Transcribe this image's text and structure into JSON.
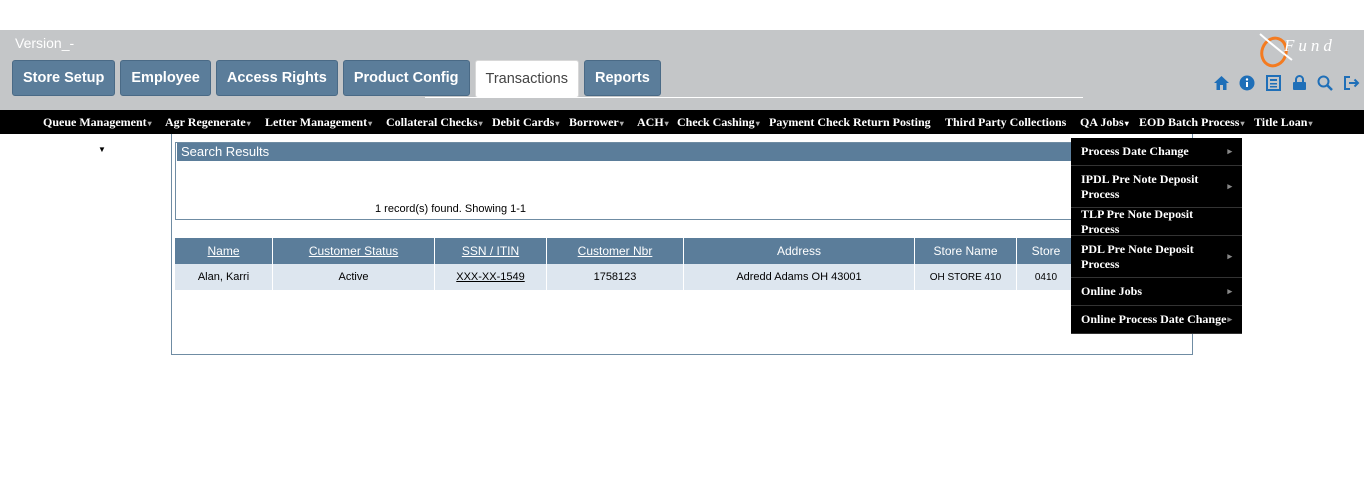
{
  "header": {
    "version": "Version_-",
    "tabs": [
      {
        "label": "Store Setup",
        "active": false
      },
      {
        "label": "Employee",
        "active": false
      },
      {
        "label": "Access Rights",
        "active": false
      },
      {
        "label": "Product Config",
        "active": false
      },
      {
        "label": "Transactions",
        "active": true
      },
      {
        "label": "Reports",
        "active": false
      }
    ],
    "logo_text": "Fund",
    "icons": [
      "home-icon",
      "info-icon",
      "calculator-icon",
      "lock-icon",
      "search-icon",
      "logout-icon"
    ]
  },
  "nav": {
    "items": [
      {
        "label": "Queue Management",
        "caret": "▾"
      },
      {
        "label": "Agr Regenerate",
        "caret": "▾"
      },
      {
        "label": "Letter Management",
        "caret": "▾"
      },
      {
        "label": "Collateral Checks",
        "caret": "▾"
      },
      {
        "label": "Debit Cards",
        "caret": "▾"
      },
      {
        "label": "Borrower",
        "caret": "▾"
      },
      {
        "label": "ACH",
        "caret": "▾"
      },
      {
        "label": "Check Cashing",
        "caret": "▾"
      },
      {
        "label": "Payment Check Return Posting",
        "caret": ""
      },
      {
        "label": "Third Party Collections",
        "caret": ""
      },
      {
        "label": "QA Jobs",
        "caret": "▾"
      },
      {
        "label": "EOD Batch Process",
        "caret": "▾"
      },
      {
        "label": "Title Loan",
        "caret": "▾"
      }
    ]
  },
  "dropdown": {
    "items": [
      {
        "label": "Process Date Change"
      },
      {
        "label": "IPDL Pre Note Deposit Process"
      },
      {
        "label": "TLP Pre Note Deposit Process"
      },
      {
        "label": "PDL Pre Note Deposit Process"
      },
      {
        "label": "Online Jobs"
      },
      {
        "label": "Online Process Date Change"
      }
    ]
  },
  "search": {
    "header": "Search Results",
    "found_text": "1 record(s) found. Showing 1-1"
  },
  "table": {
    "columns": [
      "Name",
      "Customer Status",
      "SSN / ITIN",
      "Customer Nbr",
      "Address",
      "Store Name",
      "Store"
    ],
    "rows": [
      [
        "Alan, Karri",
        "Active",
        "XXX-XX-1549",
        "1758123",
        "Adredd Adams OH 43001",
        "OH STORE 410",
        "0410"
      ]
    ]
  }
}
